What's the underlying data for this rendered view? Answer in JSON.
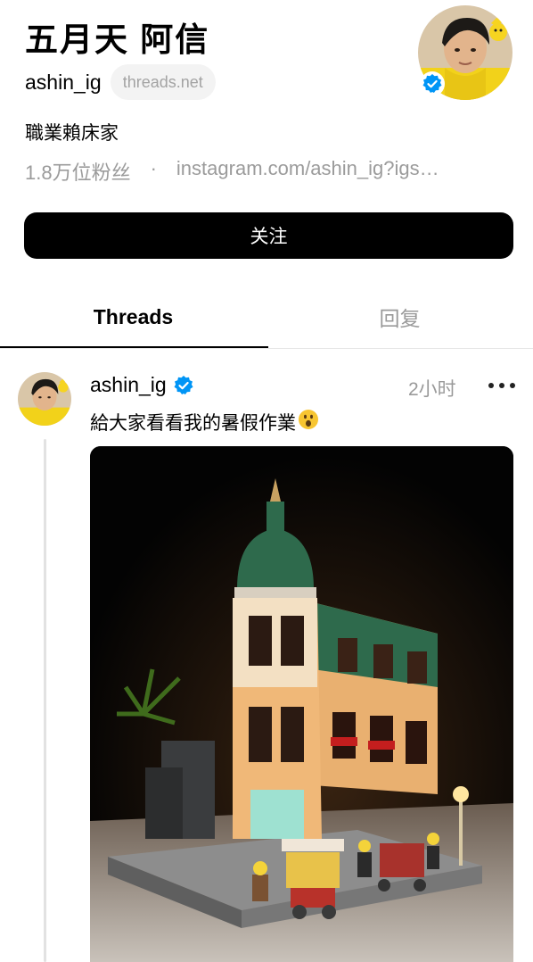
{
  "profile": {
    "name": "五月天 阿信",
    "handle": "ashin_ig",
    "domain_badge": "threads.net",
    "bio": "職業賴床家",
    "followers": "1.8万位粉丝",
    "separator": "·",
    "link": "instagram.com/ashin_ig?igs…",
    "follow_label": "关注"
  },
  "tabs": [
    {
      "label": "Threads",
      "active": true
    },
    {
      "label": "回复",
      "active": false
    }
  ],
  "post": {
    "author": "ashin_ig",
    "time": "2小时",
    "text": "給大家看看我的暑假作業",
    "emoji": "😮",
    "image_subject": "lego-boutique-hotel-photo"
  },
  "colors": {
    "accent_verified": "#0095f6",
    "button_bg": "#000000",
    "muted_text": "#9b9b9b",
    "pill_bg": "#f3f3f3"
  },
  "icons": [
    "verified-badge-icon",
    "more-options-icon",
    "thread-line",
    "surprised-face-emoji"
  ]
}
